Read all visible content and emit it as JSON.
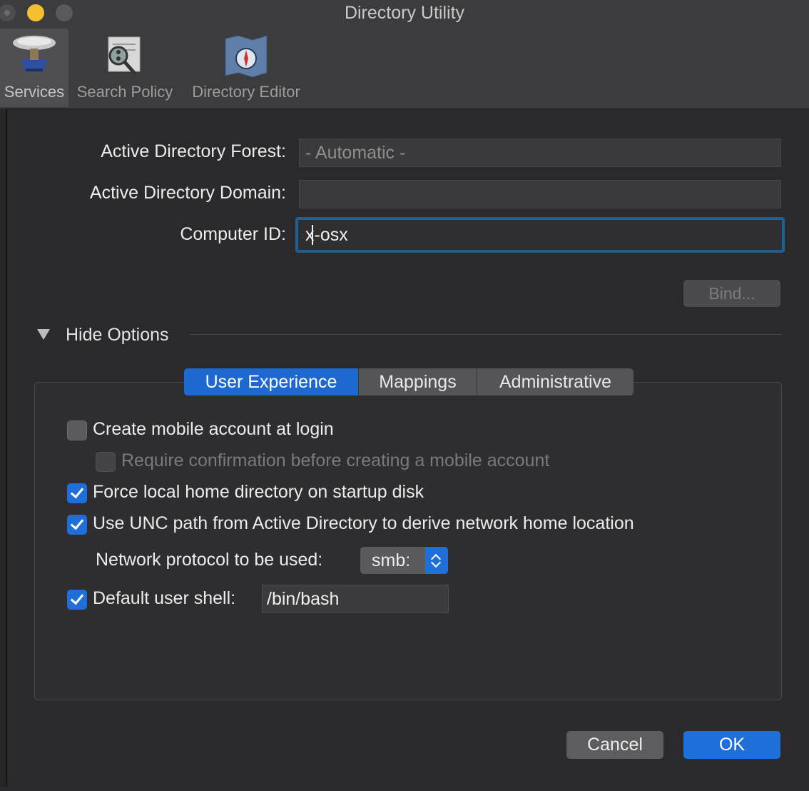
{
  "window": {
    "title": "Directory Utility"
  },
  "toolbar": {
    "items": [
      {
        "label": "Services",
        "icon": "services-icon",
        "selected": true
      },
      {
        "label": "Search Policy",
        "icon": "search-policy-icon",
        "selected": false
      },
      {
        "label": "Directory Editor",
        "icon": "directory-editor-icon",
        "selected": false
      }
    ]
  },
  "form": {
    "forest_label": "Active Directory Forest:",
    "forest_value": "- Automatic -",
    "domain_label": "Active Directory Domain:",
    "domain_value": "",
    "computer_id_label": "Computer ID:",
    "computer_id_value": "x-osx",
    "bind_label": "Bind..."
  },
  "options": {
    "toggle_label": "Hide Options",
    "tabs": [
      {
        "label": "User Experience",
        "selected": true
      },
      {
        "label": "Mappings",
        "selected": false
      },
      {
        "label": "Administrative",
        "selected": false
      }
    ],
    "checkboxes": [
      {
        "label": "Create mobile account at login",
        "checked": false,
        "enabled": true
      },
      {
        "label": "Require confirmation before creating a mobile account",
        "checked": false,
        "enabled": false
      },
      {
        "label": "Force local home directory on startup disk",
        "checked": true,
        "enabled": true
      },
      {
        "label": "Use UNC path from Active Directory to derive network home location",
        "checked": true,
        "enabled": true
      },
      {
        "label": "Default user shell:",
        "checked": true,
        "enabled": true
      }
    ],
    "protocol_label": "Network protocol to be used:",
    "protocol_value": "smb:",
    "shell_value": "/bin/bash"
  },
  "buttons": {
    "cancel": "Cancel",
    "ok": "OK"
  },
  "colors": {
    "accent": "#1e6fd9",
    "focus_ring": "#1f5f92",
    "background": "#2a2a2c"
  }
}
